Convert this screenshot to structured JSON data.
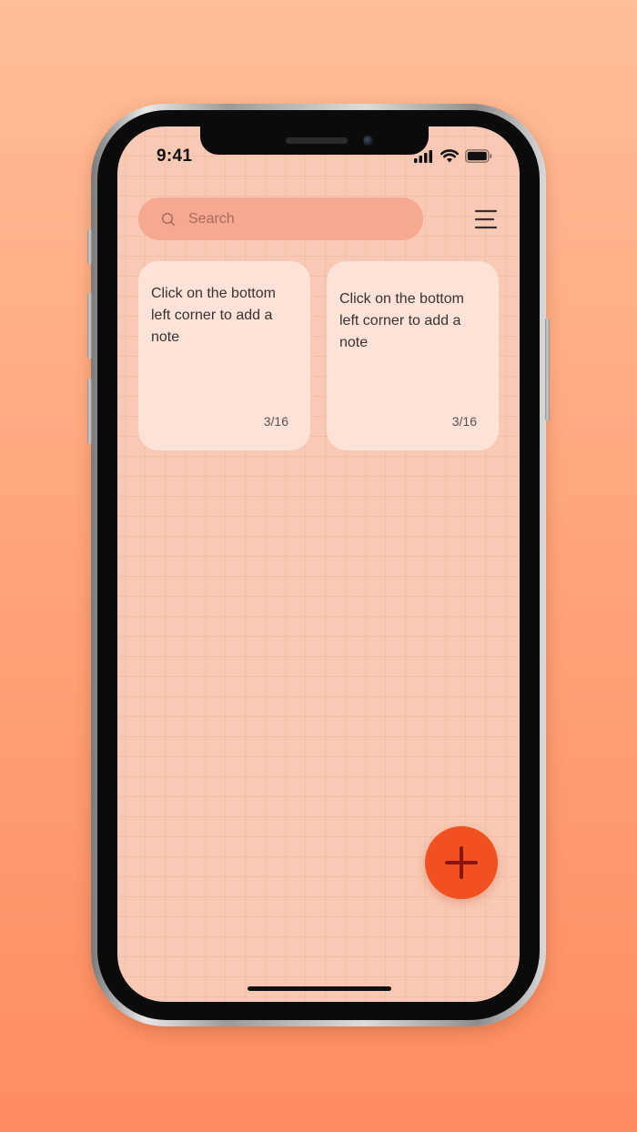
{
  "status_bar": {
    "time": "9:41"
  },
  "search": {
    "placeholder": "Search",
    "value": ""
  },
  "menu": {
    "icon": "menu-icon"
  },
  "notes": [
    {
      "text": "Click on the bottom left corner to add a note",
      "count": "3/16"
    },
    {
      "text": "Click on the bottom left corner to add a note",
      "count": "3/16"
    }
  ],
  "fab": {
    "icon": "plus-icon"
  },
  "colors": {
    "accent": "#f1501f",
    "plus": "#8a1410",
    "search_bg": "#f6a890",
    "card_bg": "#fde2d7",
    "screen_bg": "#f8c9b4"
  }
}
